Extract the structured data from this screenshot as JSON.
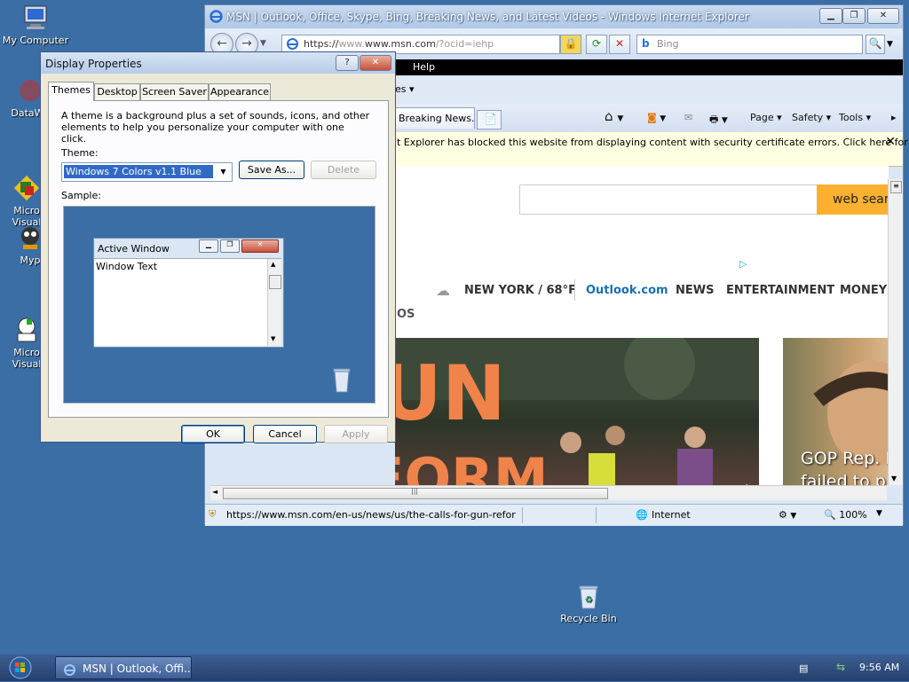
{
  "desktop": {
    "icons": [
      {
        "label": "My Computer"
      },
      {
        "label": "DataWa"
      },
      {
        "label": "Micro\nVisual"
      },
      {
        "label": "Myp"
      },
      {
        "label": "Micro\nVisual"
      },
      {
        "label": "Recycle Bin"
      }
    ]
  },
  "ie": {
    "title": "MSN | Outlook, Office, Skype, Bing, Breaking News, and Latest Videos - Windows Internet Explorer",
    "address_scheme": "https://",
    "address_host": "www.msn.com",
    "address_path": "/?ocid=iehp",
    "search_placeholder": "Bing",
    "menu": {
      "help": "Help"
    },
    "favorites_label": "es ▾",
    "tab_label": "Breaking News...",
    "commands": {
      "page": "Page ▾",
      "safety": "Safety ▾",
      "tools": "Tools ▾"
    },
    "infobar_message": "t Explorer has blocked this website from displaying content with security certificate errors. Click here for",
    "page": {
      "search_button": "web sear",
      "weather": "NEW YORK / 68°F",
      "nav": [
        "Outlook.com",
        "NEWS",
        "ENTERTAINMENT",
        "MONEY"
      ],
      "section_stub": "OS",
      "side_headline": "GOP Rep. M\nfailed to pr"
    },
    "status_url": "https://www.msn.com/en-us/news/us/the-calls-for-gun-refor",
    "zone": "Internet",
    "zoom": "100%"
  },
  "dialog": {
    "title": "Display Properties",
    "tabs": [
      "Themes",
      "Desktop",
      "Screen Saver",
      "Appearance"
    ],
    "description": "A theme is a background plus a set of sounds, icons, and other elements to help you personalize your computer with one click.",
    "theme_label": "Theme:",
    "theme_value": "Windows 7 Colors v1.1 Blue",
    "save_as": "Save As...",
    "delete": "Delete",
    "sample_label": "Sample:",
    "sample_window_title": "Active Window",
    "sample_window_text": "Window Text",
    "ok": "OK",
    "cancel": "Cancel",
    "apply": "Apply"
  },
  "taskbar": {
    "task_label": "MSN | Outlook, Offi...",
    "clock": "9:56 AM"
  }
}
